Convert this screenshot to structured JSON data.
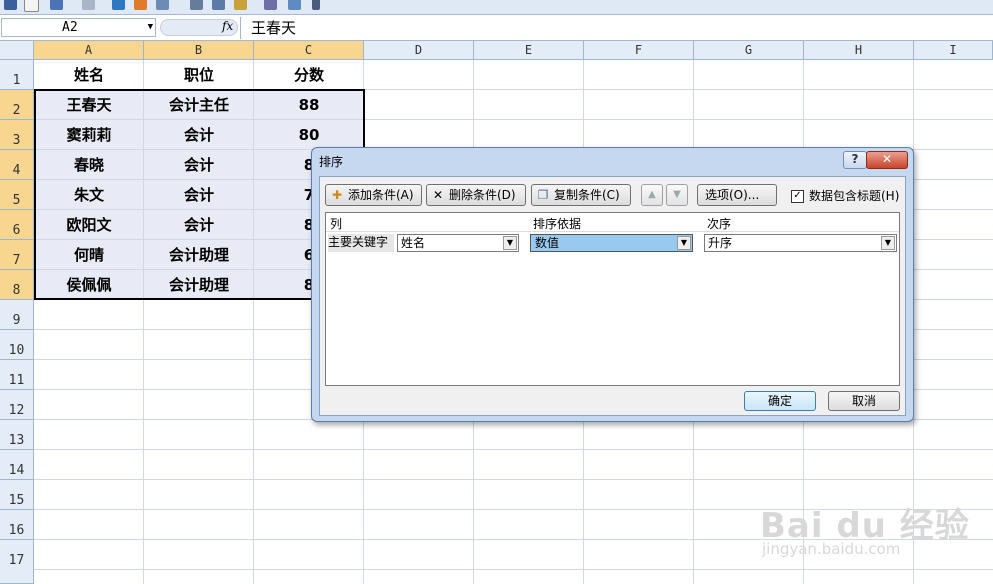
{
  "formula_bar": {
    "cell_ref": "A2",
    "fx": "fx",
    "content": "王春天"
  },
  "columns": [
    "A",
    "B",
    "C",
    "D",
    "E",
    "F",
    "G",
    "H",
    "I"
  ],
  "rows": [
    "1",
    "2",
    "3",
    "4",
    "5",
    "6",
    "7",
    "8",
    "9",
    "10",
    "11",
    "12",
    "13",
    "14",
    "15",
    "16",
    "17"
  ],
  "sheet": {
    "header": [
      "姓名",
      "职位",
      "分数"
    ],
    "data": [
      [
        "王春天",
        "会计主任",
        "88"
      ],
      [
        "窦莉莉",
        "会计",
        "80"
      ],
      [
        "春晓",
        "会计",
        "8"
      ],
      [
        "朱文",
        "会计",
        "7"
      ],
      [
        "欧阳文",
        "会计",
        "8"
      ],
      [
        "何晴",
        "会计助理",
        "6"
      ],
      [
        "侯佩佩",
        "会计助理",
        "8"
      ]
    ]
  },
  "dialog": {
    "title": "排序",
    "help": "?",
    "close": "✕",
    "add_label": "添加条件(A)",
    "delete_label": "删除条件(D)",
    "copy_label": "复制条件(C)",
    "options_label": "选项(O)...",
    "has_header_label": "数据包含标题(H)",
    "has_header_checked": "✓",
    "col_header": "列",
    "sort_on_header": "排序依据",
    "order_header": "次序",
    "row_label": "主要关键字",
    "column_value": "姓名",
    "sort_on_value": "数值",
    "order_value": "升序",
    "ok_label": "确定",
    "cancel_label": "取消"
  },
  "watermark": {
    "brand": "Bai du 经验",
    "url": "jingyan.baidu.com"
  },
  "colors": {
    "header_bg": "#e4ecf7",
    "selected_header": "#f8d68f",
    "dialog_frame": "#c5d8f0",
    "selection_blue": "#99c9ef"
  }
}
